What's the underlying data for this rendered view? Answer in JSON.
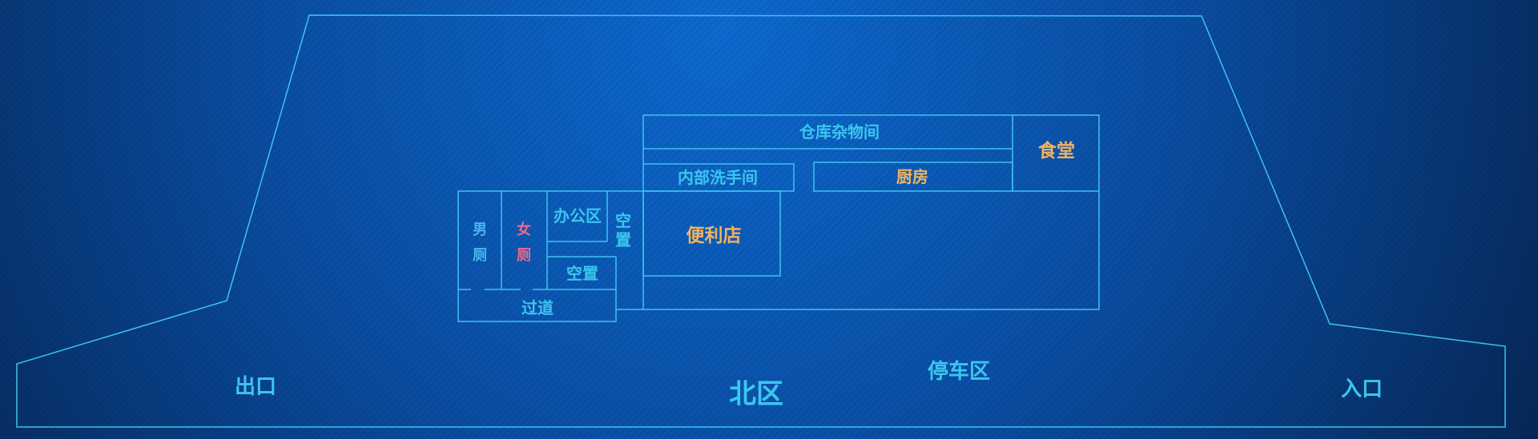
{
  "colors": {
    "line": "#3fc2ef",
    "label_cyan": "#3cc6ee",
    "label_orange": "#f2b25e",
    "label_pink": "#ec6a8e",
    "label_male": "#49b8ee",
    "bg_center": "#0a64c8",
    "bg_edge": "#06214a"
  },
  "rooms": {
    "warehouse": "仓库杂物间",
    "canteen": "食堂",
    "staff_washroom": "内部洗手间",
    "kitchen": "厨房",
    "store": "便利店",
    "mens_room_1": "男",
    "mens_room_2": "厕",
    "womens_room_1": "女",
    "womens_room_2": "厕",
    "office": "办公区",
    "vacant_vertical_1": "空",
    "vacant_vertical_2": "置",
    "vacant": "空置",
    "corridor": "过道"
  },
  "areas": {
    "exit": "出口",
    "north_zone": "北区",
    "parking": "停车区",
    "entrance": "入口"
  }
}
